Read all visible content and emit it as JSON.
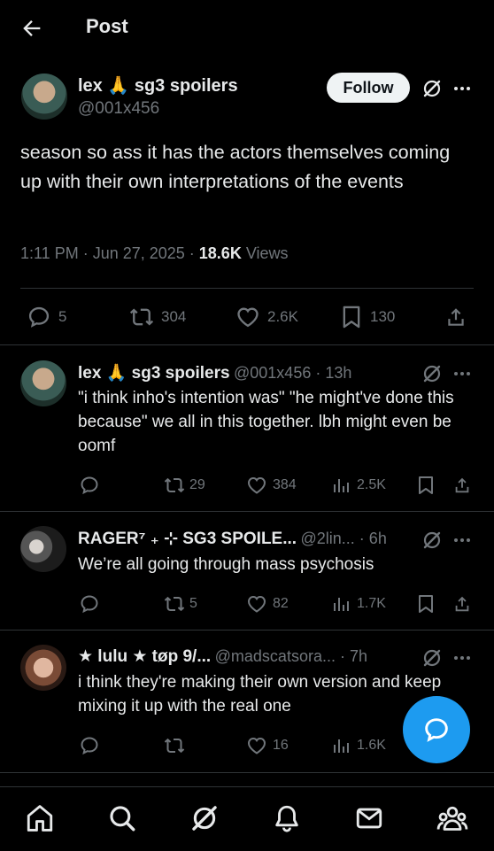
{
  "header": {
    "title": "Post",
    "back_icon": "arrow-left-icon"
  },
  "post": {
    "author_name": "lex 🙏 sg3 spoilers",
    "name_text": "lex",
    "name_suffix": "sg3 spoilers",
    "handle": "@001x456",
    "follow_label": "Follow",
    "text": "season so ass it has the actors themselves coming up with their own interpretations of the events",
    "time": "1:11 PM · Jun 27, 2025 · ",
    "views_count": "18.6K",
    "views_label": " Views",
    "replies": "5",
    "reposts": "304",
    "likes": "2.6K",
    "bookmarks": "130"
  },
  "replies": [
    {
      "name_a": "lex",
      "name_b": "sg3 spoilers",
      "meta": "@001x456 · 13h",
      "text": "\"i think inho's intention was\" \"he might've done this because\" we all in this together. lbh might even be oomf",
      "reposts": "29",
      "likes": "384",
      "views": "2.5K"
    },
    {
      "name": "RAGER⁷ ₊ ⊹ SG3 SPOILE...",
      "meta": "@2lin... · 6h",
      "text": "We’re all going through mass psychosis",
      "reposts": "5",
      "likes": "82",
      "views": "1.7K"
    },
    {
      "name": "★ lulu ★ tøp 9/...",
      "meta": "@madscatsora... · 7h",
      "text": "i think they're making their own version and keep mixing it up with the real one",
      "reposts": "",
      "likes": "16",
      "views": "1.6K"
    }
  ],
  "colors": {
    "accent": "#1d9bf0",
    "background": "#000000",
    "text": "#e7e9ea",
    "muted": "#71767b",
    "divider": "#2f3336"
  },
  "nav": [
    "home-icon",
    "search-icon",
    "grok-icon",
    "notifications-icon",
    "messages-icon",
    "communities-icon"
  ]
}
